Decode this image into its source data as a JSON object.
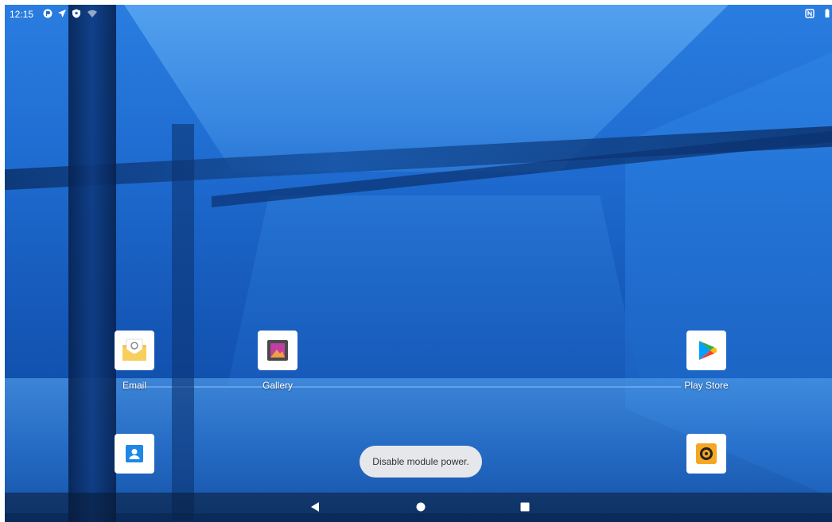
{
  "status_bar": {
    "time": "12:15",
    "left_icons": [
      "app-notification-icon",
      "location-icon",
      "shield-icon",
      "wifi-icon"
    ],
    "right_icons": [
      "nfc-icon",
      "battery-icon"
    ]
  },
  "apps": [
    {
      "id": "email",
      "label": "Email"
    },
    {
      "id": "gallery",
      "label": "Gallery"
    },
    {
      "id": "play-store",
      "label": "Play Store"
    },
    {
      "id": "contacts",
      "label": ""
    },
    {
      "id": "camera",
      "label": ""
    }
  ],
  "toast": {
    "text": "Disable module power."
  },
  "nav_bar": {
    "buttons": [
      "back",
      "home",
      "recents"
    ]
  }
}
